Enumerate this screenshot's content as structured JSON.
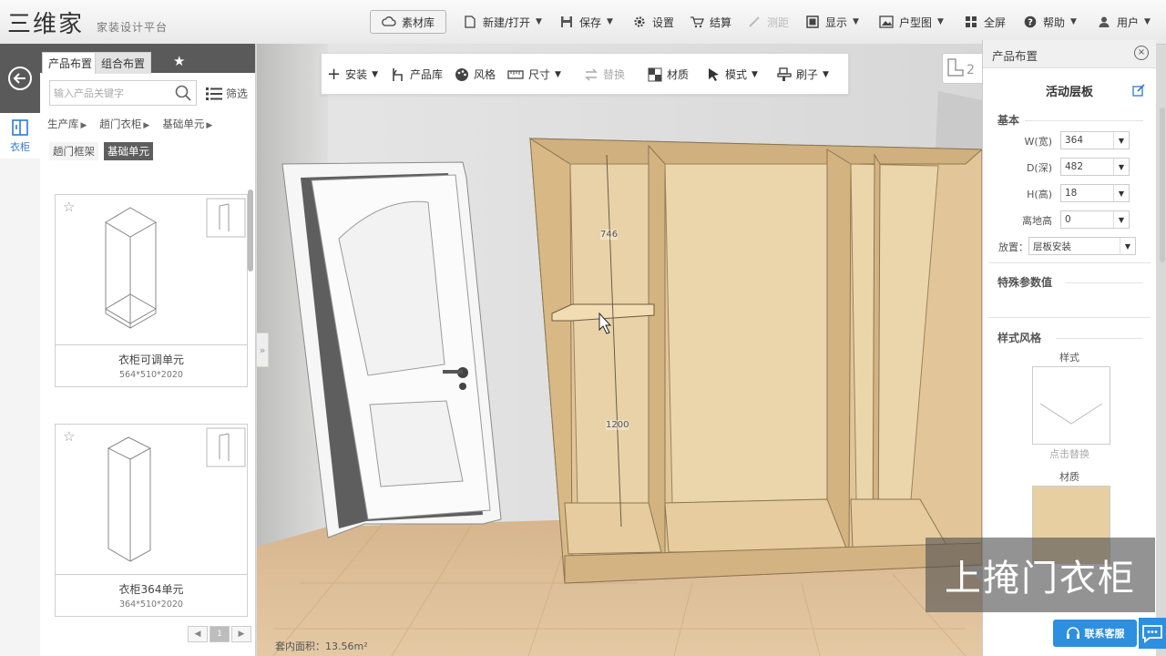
{
  "app": {
    "logo_text": "三维家",
    "subtitle": "家装设计平台"
  },
  "topbar": {
    "material_lib": "素材库",
    "new_open": "新建/打开",
    "save": "保存",
    "settings": "设置",
    "checkout": "结算",
    "measure": "测距",
    "display": "显示",
    "floorplan": "户型图",
    "fullscreen": "全屏",
    "help": "帮助",
    "user": "用户"
  },
  "rail": {
    "wardrobe": "衣柜"
  },
  "left_panel": {
    "tabs": [
      "产品布置",
      "组合布置"
    ],
    "search_placeholder": "输入产品关键字",
    "filter": "筛选",
    "breadcrumb": [
      "生产库",
      "趟门衣柜",
      "基础单元"
    ],
    "chips": [
      "趟门框架",
      "基础单元"
    ],
    "products": [
      {
        "name": "衣柜可调单元",
        "dims": "564*510*2020"
      },
      {
        "name": "衣柜364单元",
        "dims": "364*510*2020"
      }
    ],
    "page": "1"
  },
  "view_toolbar": {
    "install": "安装",
    "product_lib": "产品库",
    "style": "风格",
    "size": "尺寸",
    "replace": "替换",
    "material": "材质",
    "mode": "模式",
    "brush": "刷子"
  },
  "dimensions": {
    "upper": "746",
    "lower": "1200"
  },
  "area_text": "套内面积：13.56m²",
  "right_panel": {
    "header": "产品布置",
    "title": "活动层板",
    "section_basic": "基本",
    "fields": [
      {
        "label": "W(宽)",
        "value": "364"
      },
      {
        "label": "D(深)",
        "value": "482"
      },
      {
        "label": "H(高)",
        "value": "18"
      },
      {
        "label": "离地高",
        "value": "0"
      }
    ],
    "placement_label": "放置：",
    "placement_value": "层板安装",
    "section_special": "特殊参数值",
    "section_style": "样式风格",
    "style_label": "样式",
    "click_replace": "点击替换",
    "material_label": "材质"
  },
  "overlay": {
    "subtitle": "上掩门衣柜",
    "support": "联系客服"
  },
  "colors": {
    "wood": "#e8cfa2",
    "wood_dark": "#c9a879",
    "floor": "#d9b890",
    "wall": "#dcdcdc",
    "accent": "#2d8fe0"
  }
}
